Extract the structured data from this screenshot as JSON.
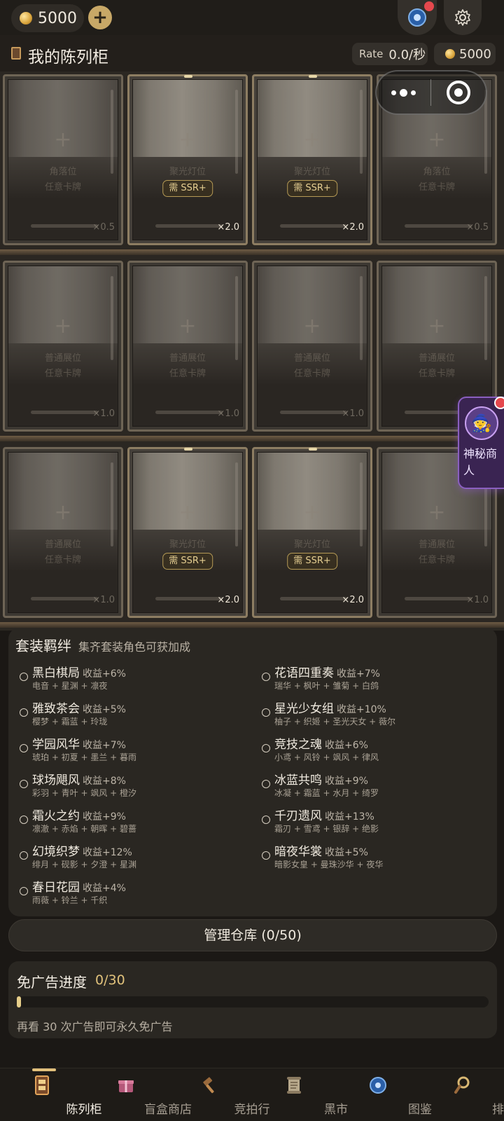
{
  "topbar": {
    "coins": "5000",
    "add_label": "+"
  },
  "header": {
    "title": "我的陈列柜",
    "rate_label": "Rate",
    "rate_value": "0.0/秒",
    "gold": "5000"
  },
  "shelves": [
    {
      "slots": [
        {
          "type": "corner",
          "plus": "+",
          "line1": "角落位",
          "line2": "任意卡牌",
          "multiplier": "×0.5"
        },
        {
          "type": "spot",
          "plus": "+",
          "line1": "聚光灯位",
          "requirement": "需 SSR+",
          "multiplier": "×2.0"
        },
        {
          "type": "spot",
          "plus": "+",
          "line1": "聚光灯位",
          "requirement": "需 SSR+",
          "multiplier": "×2.0"
        },
        {
          "type": "corner",
          "plus": "+",
          "line1": "角落位",
          "line2": "任意卡牌",
          "multiplier": "×0.5"
        }
      ]
    },
    {
      "slots": [
        {
          "type": "normal",
          "plus": "+",
          "line1": "普通展位",
          "line2": "任意卡牌",
          "multiplier": "×1.0"
        },
        {
          "type": "normal",
          "plus": "+",
          "line1": "普通展位",
          "line2": "任意卡牌",
          "multiplier": "×1.0"
        },
        {
          "type": "normal",
          "plus": "+",
          "line1": "普通展位",
          "line2": "任意卡牌",
          "multiplier": "×1.0"
        },
        {
          "type": "normal",
          "plus": "+",
          "line1": "普通展位",
          "line2": "任意卡牌",
          "multiplier": "×1.0"
        }
      ]
    },
    {
      "slots": [
        {
          "type": "normal",
          "plus": "+",
          "line1": "普通展位",
          "line2": "任意卡牌",
          "multiplier": "×1.0"
        },
        {
          "type": "spot",
          "plus": "+",
          "line1": "聚光灯位",
          "requirement": "需 SSR+",
          "multiplier": "×2.0"
        },
        {
          "type": "spot",
          "plus": "+",
          "line1": "聚光灯位",
          "requirement": "需 SSR+",
          "multiplier": "×2.0"
        },
        {
          "type": "normal",
          "plus": "+",
          "line1": "普通展位",
          "line2": "任意卡牌",
          "multiplier": "×1.0"
        }
      ]
    }
  ],
  "merchant": {
    "label": "神秘商人",
    "icon": "wizard-icon"
  },
  "sets": {
    "title": "套装羁绊",
    "subtitle": "集齐套装角色可获加成",
    "items": [
      {
        "name": "黑白棋局",
        "bonus": "收益+6%",
        "members": "电音 + 星渊 + 凛夜"
      },
      {
        "name": "花语四重奏",
        "bonus": "收益+7%",
        "members": "瑞华 + 枫叶 + 雏菊 + 白鸽"
      },
      {
        "name": "雅致茶会",
        "bonus": "收益+5%",
        "members": "樱梦 + 霜蓝 + 玲珑"
      },
      {
        "name": "星光少女组",
        "bonus": "收益+10%",
        "members": "柚子 + 织姬 + 圣光天女 + 薇尔"
      },
      {
        "name": "学园风华",
        "bonus": "收益+7%",
        "members": "琥珀 + 初夏 + 墨兰 + 暮雨"
      },
      {
        "name": "竞技之魂",
        "bonus": "收益+6%",
        "members": "小鸢 + 风铃 + 飒风 + 律风"
      },
      {
        "name": "球场飓风",
        "bonus": "收益+8%",
        "members": "彩羽 + 青叶 + 飒风 + 橙汐"
      },
      {
        "name": "冰蓝共鸣",
        "bonus": "收益+9%",
        "members": "冰凝 + 霜蓝 + 水月 + 绮罗"
      },
      {
        "name": "霜火之约",
        "bonus": "收益+9%",
        "members": "凛澈 + 赤焰 + 朝晖 + 碧蔷"
      },
      {
        "name": "千刃遗风",
        "bonus": "收益+13%",
        "members": "霜刃 + 雪鸢 + 银辞 + 绝影"
      },
      {
        "name": "幻境织梦",
        "bonus": "收益+12%",
        "members": "绯月 + 砚影 + 夕澄 + 星渊"
      },
      {
        "name": "暗夜华裳",
        "bonus": "收益+5%",
        "members": "暗影女皇 + 曼珠沙华 + 夜华"
      },
      {
        "name": "春日花园",
        "bonus": "收益+4%",
        "members": "雨薇 + 铃兰 + 千织"
      }
    ]
  },
  "warehouse": {
    "label": "管理仓库 (0/50)"
  },
  "adfree": {
    "title": "免广告进度",
    "count": "0/30",
    "progress": 0,
    "note": "再看 30 次广告即可永久免广告"
  },
  "nav": [
    {
      "label": "陈列柜",
      "icon": "cabinet-icon",
      "active": true
    },
    {
      "label": "盲盒商店",
      "icon": "gift-box-icon",
      "active": false
    },
    {
      "label": "竞拍行",
      "icon": "gavel-icon",
      "active": false
    },
    {
      "label": "黑市",
      "icon": "scroll-icon",
      "active": false
    },
    {
      "label": "图鉴",
      "icon": "compass-icon",
      "active": false
    },
    {
      "label": "排行",
      "icon": "magnifier-icon",
      "active": false
    }
  ],
  "colors": {
    "background": "#1b1815",
    "accent_gold": "#e2c07c",
    "merchant_purple": "#3a2452"
  }
}
